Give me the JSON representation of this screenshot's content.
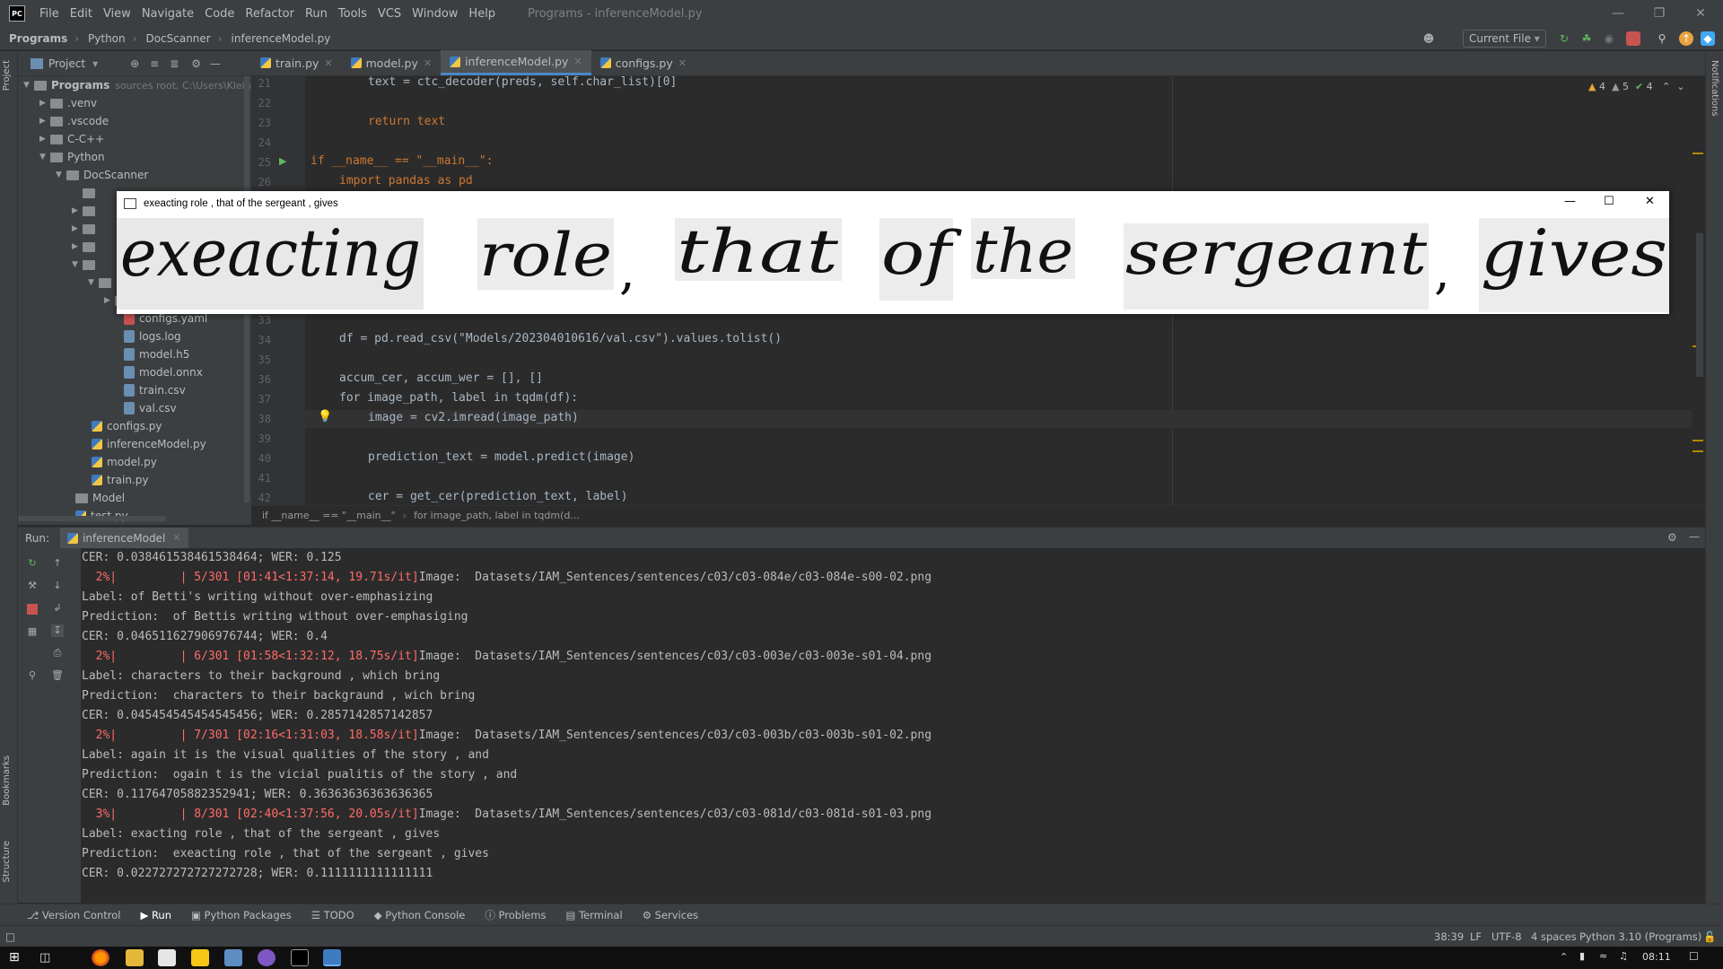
{
  "window": {
    "logo": "PC",
    "menu": [
      "File",
      "Edit",
      "View",
      "Navigate",
      "Code",
      "Refactor",
      "Run",
      "Tools",
      "VCS",
      "Window",
      "Help"
    ],
    "title": "Programs - inferenceModel.py"
  },
  "navbar": {
    "crumbs": [
      "Programs",
      "Python",
      "DocScanner",
      "inferenceModel.py"
    ],
    "run_config": "Current File"
  },
  "project": {
    "header": "Project",
    "root_label": "Programs",
    "root_note": "sources root,  C:\\Users\\Klein\\D",
    "tree": [
      {
        "label": ".venv",
        "kind": "folder"
      },
      {
        "label": ".vscode",
        "kind": "folder"
      },
      {
        "label": "C-C++",
        "kind": "folder"
      },
      {
        "label": "Python",
        "kind": "folder"
      },
      {
        "label": "DocScanner",
        "kind": "folder"
      },
      {
        "label": "configs.yaml",
        "kind": "file"
      },
      {
        "label": "logs.log",
        "kind": "file"
      },
      {
        "label": "model.h5",
        "kind": "file"
      },
      {
        "label": "model.onnx",
        "kind": "file"
      },
      {
        "label": "train.csv",
        "kind": "file"
      },
      {
        "label": "val.csv",
        "kind": "file"
      },
      {
        "label": "configs.py",
        "kind": "py"
      },
      {
        "label": "inferenceModel.py",
        "kind": "py"
      },
      {
        "label": "model.py",
        "kind": "py"
      },
      {
        "label": "train.py",
        "kind": "py"
      },
      {
        "label": "Model",
        "kind": "folder"
      },
      {
        "label": "test.py",
        "kind": "py"
      }
    ]
  },
  "tabs": [
    "train.py",
    "model.py",
    "inferenceModel.py",
    "configs.py"
  ],
  "inspections": {
    "warnings_a": "4",
    "warnings_b": "5",
    "ok": "4"
  },
  "editor": {
    "lines": [
      {
        "n": "21",
        "code": "text = ctc_decoder(preds, self.char_list)[0]"
      },
      {
        "n": "22",
        "code": ""
      },
      {
        "n": "23",
        "code": "return text"
      },
      {
        "n": "24",
        "code": ""
      },
      {
        "n": "25",
        "code": "if __name__ == \"__main__\":"
      },
      {
        "n": "26",
        "code": "import pandas as pd"
      },
      {
        "n": "33",
        "code": ""
      },
      {
        "n": "34",
        "code": "df = pd.read_csv(\"Models/202304010616/val.csv\").values.tolist()"
      },
      {
        "n": "35",
        "code": ""
      },
      {
        "n": "36",
        "code": "accum_cer, accum_wer = [], []"
      },
      {
        "n": "37",
        "code": "for image_path, label in tqdm(df):"
      },
      {
        "n": "38",
        "code": "image = cv2.imread(image_path)"
      },
      {
        "n": "39",
        "code": ""
      },
      {
        "n": "40",
        "code": "prediction_text = model.predict(image)"
      },
      {
        "n": "41",
        "code": ""
      },
      {
        "n": "42",
        "code": "cer = get_cer(prediction_text, label)"
      }
    ],
    "breadcrumb": [
      "if __name__ == \"__main__\"",
      "for image_path, label in tqdm(d..."
    ]
  },
  "popup": {
    "title": "exeacting role , that of the sergeant , gives",
    "handwriting_words": [
      "exeacting",
      "role",
      ",",
      "that",
      "of",
      "the",
      "sergeant",
      ",",
      "gives"
    ]
  },
  "run": {
    "label": "Run:",
    "config": "inferenceModel",
    "console": [
      {
        "text": "CER: 0.038461538461538464; WER: 0.125",
        "kind": "plain"
      },
      {
        "prefix": "  2%|         | 5/301 [01:41<1:37:14, 19.71s/it]",
        "text": "Image:  Datasets/IAM_Sentences/sentences/c03/c03-084e/c03-084e-s00-02.png",
        "kind": "progress"
      },
      {
        "text": "Label: of Betti's writing without over-emphasizing",
        "kind": "plain"
      },
      {
        "text": "Prediction:  of Bettis writing without over-emphasiging",
        "kind": "plain"
      },
      {
        "text": "CER: 0.046511627906976744; WER: 0.4",
        "kind": "plain"
      },
      {
        "prefix": "  2%|         | 6/301 [01:58<1:32:12, 18.75s/it]",
        "text": "Image:  Datasets/IAM_Sentences/sentences/c03/c03-003e/c03-003e-s01-04.png",
        "kind": "progress"
      },
      {
        "text": "Label: characters to their background , which bring",
        "kind": "plain"
      },
      {
        "text": "Prediction:  characters to their backgraund , wich bring",
        "kind": "plain"
      },
      {
        "text": "CER: 0.045454545454545456; WER: 0.2857142857142857",
        "kind": "plain"
      },
      {
        "prefix": "  2%|         | 7/301 [02:16<1:31:03, 18.58s/it]",
        "text": "Image:  Datasets/IAM_Sentences/sentences/c03/c03-003b/c03-003b-s01-02.png",
        "kind": "progress"
      },
      {
        "text": "Label: again it is the visual qualities of the story , and",
        "kind": "plain"
      },
      {
        "text": "Prediction:  ogain t is the vicial pualitis of the story , and",
        "kind": "plain"
      },
      {
        "text": "CER: 0.11764705882352941; WER: 0.36363636363636365",
        "kind": "plain"
      },
      {
        "prefix": "  3%|         | 8/301 [02:40<1:37:56, 20.05s/it]",
        "text": "Image:  Datasets/IAM_Sentences/sentences/c03/c03-081d/c03-081d-s01-03.png",
        "kind": "progress"
      },
      {
        "text": "Label: exacting role , that of the sergeant , gives",
        "kind": "plain"
      },
      {
        "text": "Prediction:  exeacting role , that of the sergeant , gives",
        "kind": "plain"
      },
      {
        "text": "CER: 0.022727272727272728; WER: 0.1111111111111111",
        "kind": "plain"
      }
    ]
  },
  "bottom_tabs": [
    "Version Control",
    "Run",
    "Python Packages",
    "TODO",
    "Python Console",
    "Problems",
    "Terminal",
    "Services"
  ],
  "side_labels": {
    "project": "Project",
    "bookmarks": "Bookmarks",
    "structure": "Structure",
    "notifications": "Notifications"
  },
  "status": {
    "position": "38:39",
    "line_sep": "LF",
    "encoding": "UTF-8",
    "indent": "4 spaces",
    "interpreter": "Python 3.10 (Programs)"
  },
  "taskbar": {
    "time": "08:11"
  },
  "colors": {
    "accent": "#4a88c7",
    "error": "#ff6b68",
    "keyword": "#cc7832",
    "string": "#6a8759"
  }
}
